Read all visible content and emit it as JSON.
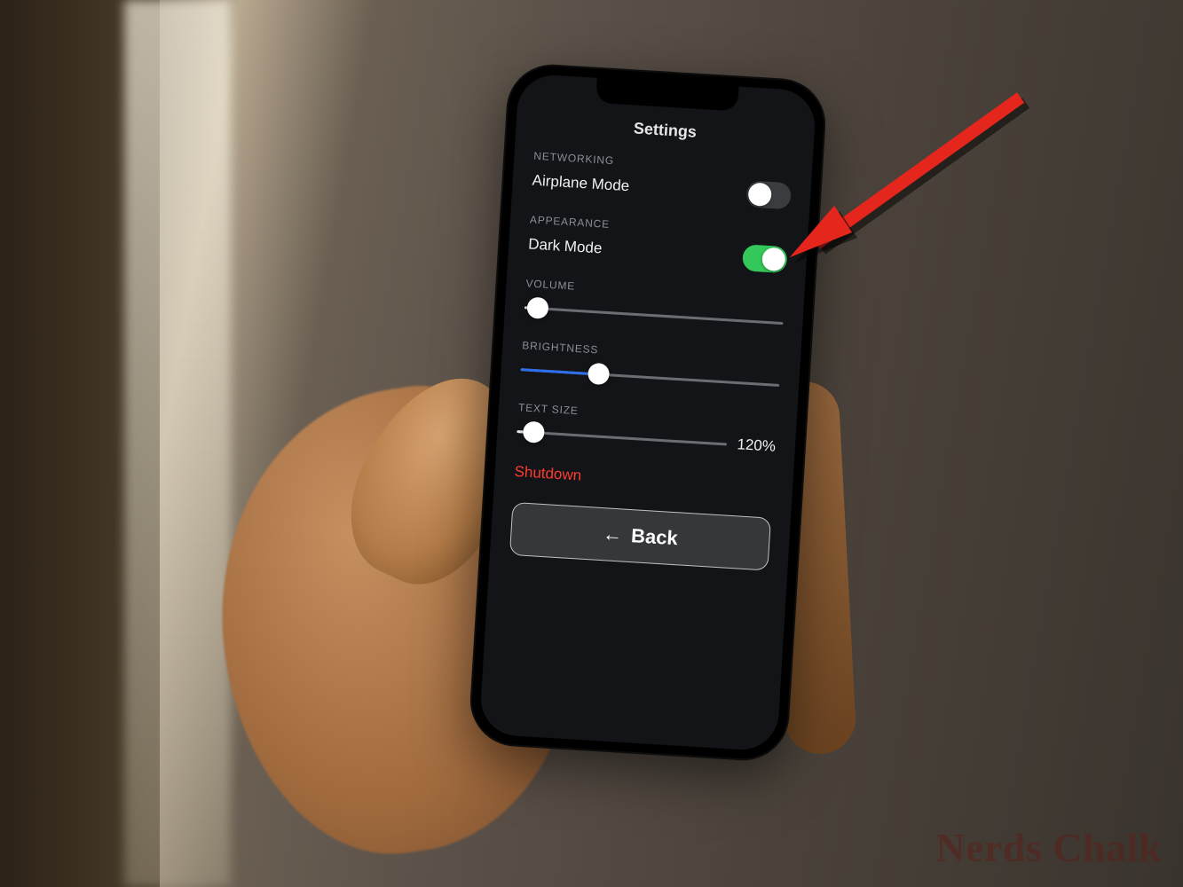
{
  "watermark": "Nerds Chalk",
  "screen": {
    "title": "Settings",
    "networking": {
      "header": "NETWORKING",
      "airplane_label": "Airplane Mode",
      "airplane_on": false
    },
    "appearance": {
      "header": "APPEARANCE",
      "darkmode_label": "Dark Mode",
      "darkmode_on": true
    },
    "volume": {
      "header": "VOLUME",
      "percent": 5
    },
    "brightness": {
      "header": "BRIGHTNESS",
      "percent": 30
    },
    "textsize": {
      "header": "TEXT SIZE",
      "percent": 8,
      "value_label": "120%"
    },
    "shutdown_label": "Shutdown",
    "back_label": "Back"
  },
  "annotation": {
    "target": "airplane-mode-toggle",
    "color": "#e5261c"
  }
}
